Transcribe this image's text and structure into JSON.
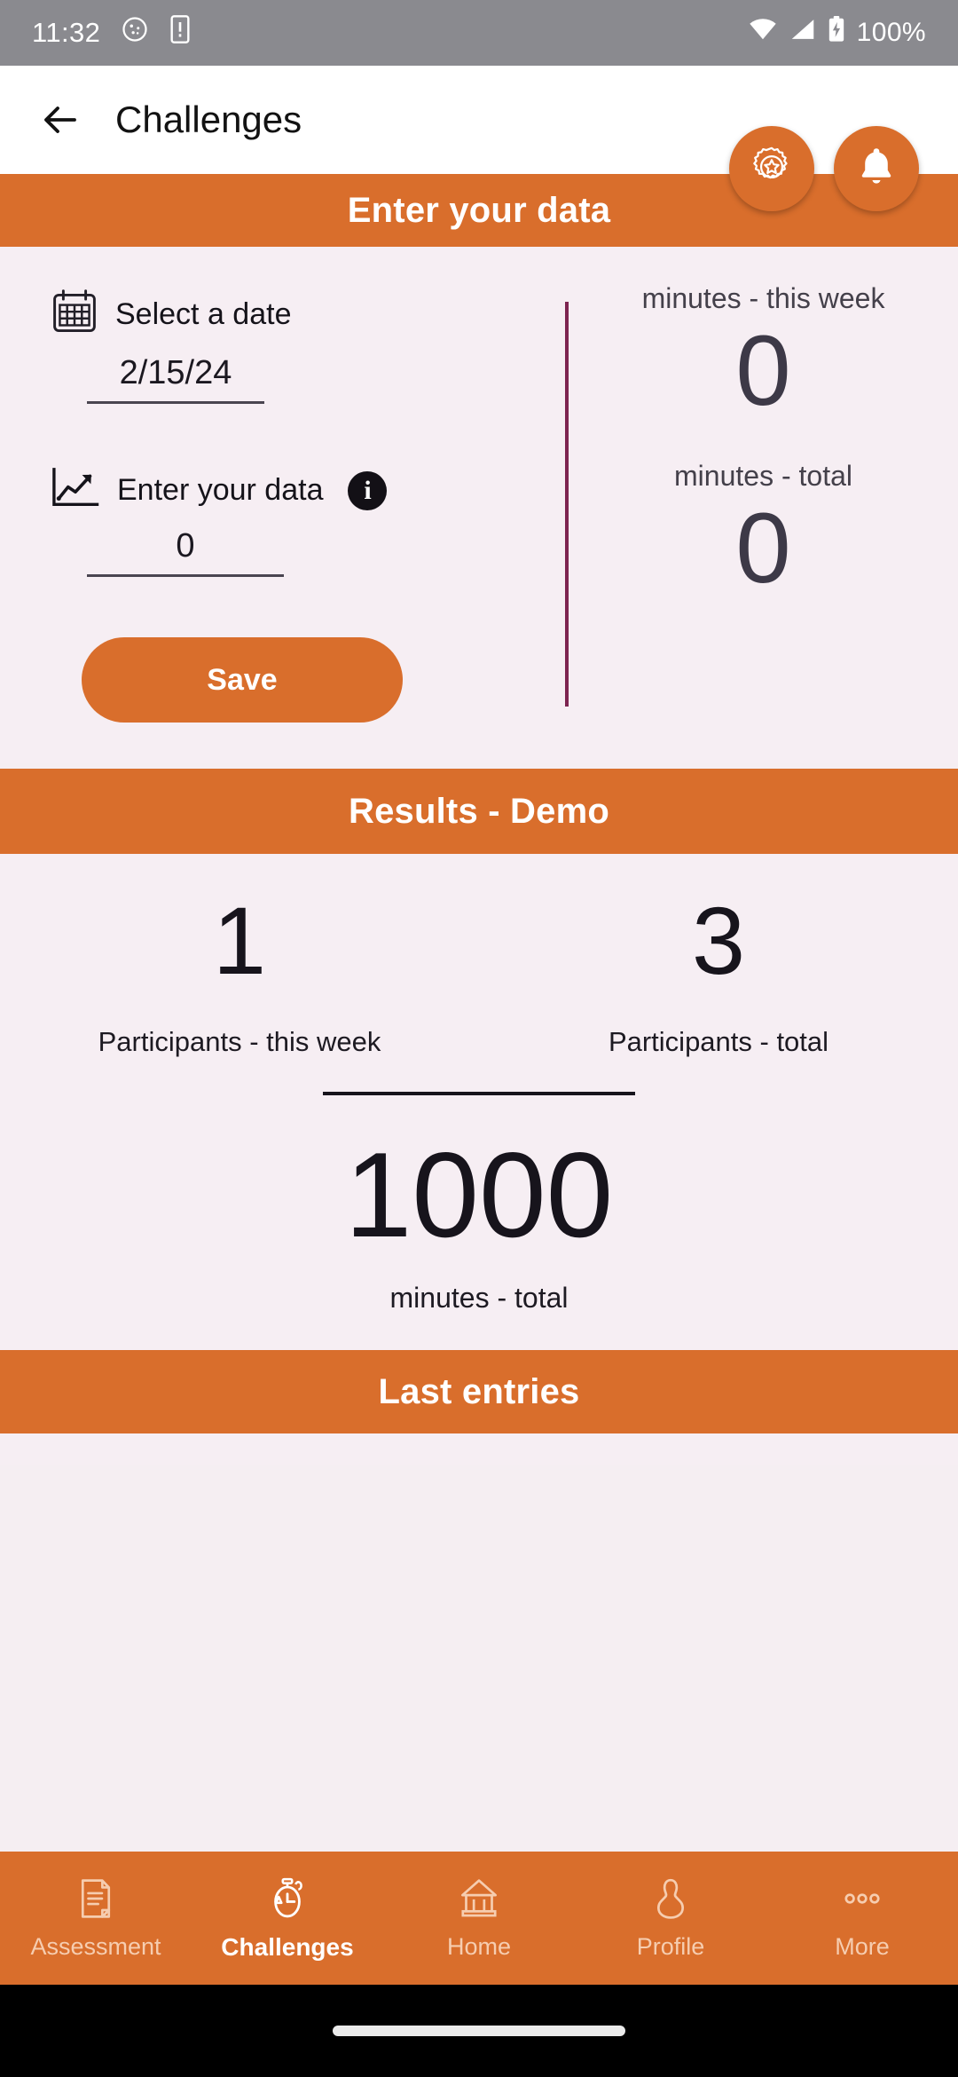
{
  "status_bar": {
    "time": "11:32",
    "battery_text": "100%",
    "icons": [
      "cookie-notification-icon",
      "sim-alert-icon",
      "wifi-icon",
      "cellular-signal-icon",
      "battery-charging-icon"
    ]
  },
  "app_bar": {
    "back_label": "back",
    "title": "Challenges"
  },
  "fabs": [
    {
      "name": "badge-award-icon",
      "label": "Awards"
    },
    {
      "name": "bell-icon",
      "label": "Notifications"
    }
  ],
  "enter_section": {
    "band_title": "Enter your data",
    "date_field": {
      "icon": "calendar-icon",
      "label": "Select a date",
      "value": "2/15/24"
    },
    "data_field": {
      "icon": "trending-up-chart-icon",
      "label": "Enter your data",
      "info_icon": "info-icon",
      "info_glyph": "i",
      "value": "0"
    },
    "save_label": "Save",
    "stats": [
      {
        "label": "minutes - this week",
        "value": "0"
      },
      {
        "label": "minutes - total",
        "value": "0"
      }
    ]
  },
  "results_section": {
    "band_title": "Results - Demo",
    "columns": [
      {
        "value": "1",
        "label": "Participants - this week"
      },
      {
        "value": "3",
        "label": "Participants - total"
      }
    ],
    "total": {
      "value": "1000",
      "label": "minutes - total"
    }
  },
  "last_entries": {
    "band_title": "Last entries"
  },
  "bottom_nav": {
    "items": [
      {
        "label": "Assessment",
        "icon": "document-icon",
        "active": false
      },
      {
        "label": "Challenges",
        "icon": "stopwatch-icon",
        "active": true
      },
      {
        "label": "Home",
        "icon": "home-icon",
        "active": false
      },
      {
        "label": "Profile",
        "icon": "person-icon",
        "active": false
      },
      {
        "label": "More",
        "icon": "more-dots-icon",
        "active": false
      }
    ]
  },
  "colors": {
    "accent_orange": "#d96e2c",
    "background": "#f6eef3",
    "divider_purple": "#7d2450",
    "status_bar_gray": "#8a8a8f",
    "nav_inactive": "#f6cdb0"
  }
}
